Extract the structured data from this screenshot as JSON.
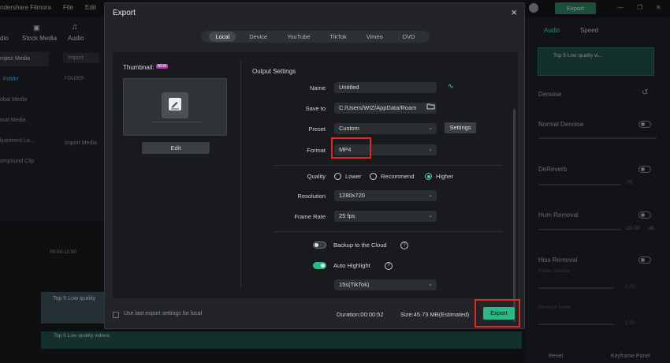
{
  "app": {
    "title": "ndershare Filmora",
    "menu": [
      "File",
      "Edit"
    ],
    "export_button": "Export",
    "left_tabs": [
      "dio",
      "Stock Media",
      "Audio"
    ],
    "left_items": [
      "roject Media",
      "Folder",
      "obal Media",
      "oud Media",
      "ljustment La...",
      "ompound Clip"
    ],
    "import_label": "Import",
    "folder_label": "FOLDER",
    "import_media": "Import Media",
    "timecode": "00:00:11:00",
    "track_clip": "Top 5 Low quality",
    "audio_track": "Top 5 Low quality videos",
    "right_tabs": [
      "Audio",
      "Speed"
    ],
    "audio_clip": "Top 5 Low quality vi...",
    "denoise": "Denoise",
    "normal_denoise": "Normal Denoise",
    "dereverb": "DeReverb",
    "dereverb_value": "70",
    "hum_removal": "Hum Removal",
    "hum_value": "-25.00",
    "hum_unit": "dB",
    "hiss_removal": "Hiss Removal",
    "noise_volume": "Noise Volume",
    "hiss_value1": "5.00",
    "denoise_level": "Denoise Level",
    "hiss_value2": "3.00",
    "reset": "Reset",
    "keyframe_panel": "Keyframe Panel"
  },
  "dialog": {
    "title": "Export",
    "close": "×",
    "tabs": [
      "Local",
      "Device",
      "YouTube",
      "TikTok",
      "Vimeo",
      "DVD"
    ],
    "active_tab": "Local",
    "thumbnail_label": "Thumbnail:",
    "new_badge": "NEW",
    "edit_label": "Edit",
    "output_title": "Output Settings",
    "name_label": "Name",
    "name_value": "Untitled",
    "save_label": "Save to",
    "save_value": "C:/Users/WIZ/AppData/Roam",
    "preset_label": "Preset",
    "preset_value": "Custom",
    "settings_label": "Settings",
    "format_label": "Format",
    "format_value": "MP4",
    "quality_label": "Quality",
    "quality_options": [
      "Lower",
      "Recommend",
      "Higher"
    ],
    "quality_selected": "Higher",
    "resolution_label": "Resolution",
    "resolution_value": "1280x720",
    "framerate_label": "Frame Rate",
    "framerate_value": "25 fps",
    "backup_label": "Backup to the Cloud",
    "backup_on": false,
    "highlight_label": "Auto Highlight",
    "highlight_on": true,
    "highlight_value": "15s(TikTok)",
    "use_last_label": "Use last export settings for local",
    "duration": "Duration:00:00:52",
    "size": "Size:45.73 MB(Estimated)",
    "export_label": "Export"
  },
  "colors": {
    "accent": "#2bb884",
    "highlight_box": "#e3262b"
  }
}
